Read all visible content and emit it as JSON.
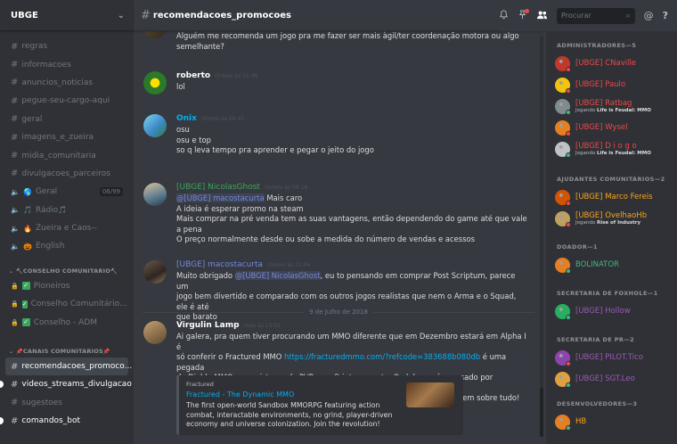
{
  "server": {
    "name": "UBGE",
    "menu_icon": "chevron-down-icon"
  },
  "channels": [
    {
      "type": "text",
      "name": "regras"
    },
    {
      "type": "text",
      "name": "informacoes"
    },
    {
      "type": "text",
      "name": "anuncios_noticias"
    },
    {
      "type": "text",
      "name": "pegue-seu-cargo-aqui"
    },
    {
      "type": "text",
      "name": "geral"
    },
    {
      "type": "text",
      "name": "imagens_e_zueira"
    },
    {
      "type": "text",
      "name": "midia_comunitaria"
    },
    {
      "type": "text",
      "name": "divulgacoes_parceiros"
    },
    {
      "type": "voice",
      "name": "Geral",
      "emoji": "🌎",
      "count": "06/99"
    },
    {
      "type": "voice",
      "name": "Rádio",
      "emoji": "🎵",
      "suffix": "🎵"
    },
    {
      "type": "voice",
      "name": "Zueira e Caos--",
      "emoji": "🔥"
    },
    {
      "type": "voice",
      "name": "English",
      "emoji": "🎃"
    }
  ],
  "categories": {
    "conselho": {
      "label": "CONSELHO COMUNITARIO",
      "icon": "🔨"
    },
    "canais": {
      "label": "CANAIS COMUNITARIOS",
      "icon": "📌"
    }
  },
  "conselho_channels": [
    "Pioneiros",
    "Conselho Comunitário...",
    "Conselho - ADM"
  ],
  "canais_channels": [
    {
      "name": "recomendacoes_promoco...",
      "active": true
    },
    {
      "name": "videos_streams_divulgacao",
      "unread": true
    },
    {
      "name": "sugestoes"
    },
    {
      "name": "comandos_bot",
      "unread": true
    }
  ],
  "header": {
    "channel": "recomendacoes_promocoes"
  },
  "toolbar": {
    "search_placeholder": "Procurar",
    "icons": [
      "bell-icon",
      "pin-icon",
      "members-icon",
      "at-icon",
      "help-icon"
    ],
    "at": "@",
    "help": "?"
  },
  "messages": [
    {
      "lines": [
        "Alguém me recomenda um jogo pra me fazer ser mais àgil/ter coordenação motora ou algo",
        "semelhante?"
      ]
    },
    {
      "user": "roberto",
      "color": "#ffffff",
      "time": "Ontem às 01:46",
      "lines": [
        "lol"
      ]
    },
    {
      "user": "Onix",
      "color": "#00b0f4",
      "time": "Ontem às 06:47",
      "lines": [
        "osu",
        "osu e top",
        "so q leva tempo pra aprender e pegar o jeito do jogo"
      ]
    },
    {
      "user": "[UBGE] NicolasGhost",
      "color": "#3aa55d",
      "time": "Ontem às 09:18",
      "mention": "@[UBGE] macostacurta",
      "first_rest": " Mais caro",
      "lines": [
        "A ideia é esperar promo na steam",
        "Mais comprar na pré venda tem as suas vantagens, então dependendo do game até que vale a pena",
        "O preço normalmente desde ou sobe a medida do número de vendas e acessos"
      ]
    },
    {
      "user": "[UBGE] macostacurta",
      "color": "#7289da",
      "time": "Ontem às 11:04",
      "prefix": "Muito obrigado ",
      "mention": "@[UBGE] NicolasGhost",
      "first_rest": ", eu to pensando em comprar Post Scriptum, parece um",
      "lines": [
        "jogo bem divertido e comparado com os outros jogos realistas que nem o Arma e o Squad, ele é até",
        "que barato"
      ]
    },
    {
      "user": "Virgulin Lamp",
      "color": "#ffffff",
      "time": "Hoje às 13:02",
      "lines": [
        "Ai galera, pra quem tiver procurando um MMO diferente que em Dezembro estará em Alpha I é"
      ],
      "line2_prefix": "só conferir o Fractured MMO ",
      "link": "https://fracturedmmo.com/?refcode=383688b080db",
      "line2_suffix": " é uma pegada",
      "lines_after": [
        "de Diablo MMO, com sistema de PVP e craft interessante. O alpha será acessado por kickstarter mas",
        "tem uma opção de um pré-alpha gratuito, só da uma olhada nos FAQ's que tem sobre tudo!"
      ]
    }
  ],
  "date_divider": "9 de Julho de 2018",
  "embed": {
    "provider": "Fractured",
    "title": "Fractured - The Dynamic MMO",
    "desc": [
      "The first open-world Sandbox MMORPG featuring action",
      "combat, interactable environments, no grind, player-driven",
      "economy and universe colonization. Join the revolution!"
    ]
  },
  "member_roles": [
    {
      "label": "ADMINISTRADORES—5",
      "members": [
        {
          "name": "[UBGE] CNaville",
          "color": "#f04747",
          "status": "#f04747"
        },
        {
          "name": "[UBGE] Paulo",
          "color": "#f04747",
          "status": "#f04747"
        },
        {
          "name": "[UBGE] Ratbag",
          "color": "#f04747",
          "status": "#43b581",
          "activity_prefix": "Jogando ",
          "activity": "Life is Feudal: MMO"
        },
        {
          "name": "[UBGE] Wysel",
          "color": "#f04747",
          "status": "#f04747"
        },
        {
          "name": "[UBGE] D i o g o",
          "color": "#f04747",
          "status": "#43b581",
          "activity_prefix": "Jogando ",
          "activity": "Life is Feudal: MMO"
        }
      ]
    },
    {
      "label": "AJUDANTES COMUNITÁRIOS—2",
      "members": [
        {
          "name": "[UBGE] Marco Fereis",
          "color": "#faa61a",
          "status": "#f04747"
        },
        {
          "name": "[UBGE] OvelhaoHb",
          "color": "#faa61a",
          "status": "#f04747",
          "activity_prefix": "Jogando ",
          "activity": "Rise of Industry"
        }
      ]
    },
    {
      "label": "DOADOR—1",
      "members": [
        {
          "name": "BOLINATOR",
          "color": "#43b581",
          "status": "#43b581"
        }
      ]
    },
    {
      "label": "SECRETARIA DE FOXHOLE—1",
      "members": [
        {
          "name": "[UBGE] Hollow",
          "color": "#9b59b6",
          "status": "#43b581"
        }
      ]
    },
    {
      "label": "SECRETARIA DE PR—2",
      "members": [
        {
          "name": "[UBGE] PILOT.Tico",
          "color": "#9b59b6",
          "status": "#f04747"
        },
        {
          "name": "[UBGE] SGT.Leo",
          "color": "#9b59b6",
          "status": "#43b581"
        }
      ]
    },
    {
      "label": "DESENVOLVEDORES—3",
      "members": [
        {
          "name": "HB",
          "color": "#faa61a",
          "status": "#43b581"
        }
      ]
    }
  ]
}
